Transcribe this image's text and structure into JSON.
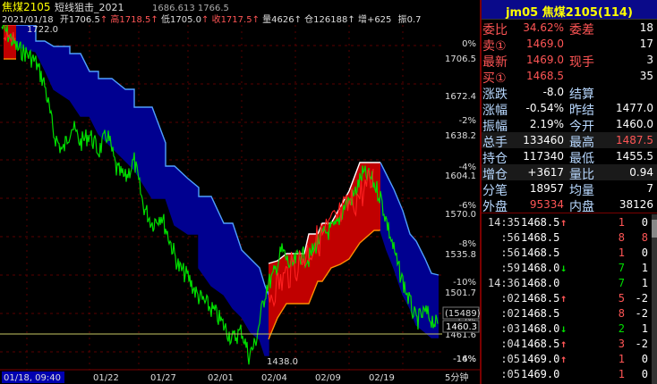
{
  "chart": {
    "symbol": "焦煤2105",
    "indicator": "短线狙击_2021",
    "indicator_values": "1686.613  1766.5",
    "info_date": "2021/01/18",
    "info_open_label": "开",
    "info_open": "1706.5",
    "info_high_label": "高",
    "info_high": "1718.5",
    "info_low_label": "低",
    "info_low": "1705.0",
    "info_close_label": "收",
    "info_close": "1717.5",
    "info_vol_label": "量",
    "info_vol": "4626",
    "info_oi_label": "仓",
    "info_oi": "126188",
    "info_add_label": "增",
    "info_add": "+625",
    "info_amp_label": "振",
    "info_amp": "0.7",
    "y_labels": [
      {
        "pct": "0%",
        "price": "1706.5"
      },
      {
        "pct": "-2%",
        "price": "1672.4"
      },
      {
        "pct": "-4%",
        "price": "1638.2"
      },
      {
        "pct": "-6%",
        "price": "1604.1"
      },
      {
        "pct": "-8%",
        "price": "1570.0"
      },
      {
        "pct": "-10%",
        "price": "1535.8"
      },
      {
        "pct": "-12%",
        "price": "1501.7"
      },
      {
        "pct": "-14%",
        "price": "1461.6"
      },
      {
        "pct": "-16%",
        "price": ""
      }
    ],
    "price_max_label": "1722.0",
    "price_min_label": "1438.0",
    "current_price": "1460.3",
    "current_count": "(15489)",
    "x_labels": [
      "01/18, 09:40",
      "01/22",
      "01/27",
      "02/01",
      "02/04",
      "02/09",
      "02/19"
    ],
    "period": "5分钟",
    "colors": {
      "bull_band": "#c00000",
      "bear_band": "#000080",
      "price_up": "#00e000",
      "grid": "#5a0000"
    }
  },
  "panel": {
    "header": "jm05 焦煤2105(114)",
    "rows": [
      {
        "l1": "委比",
        "v1": "34.62%",
        "c1": "red",
        "l2": "委差",
        "v2": "18",
        "c2": "wht"
      },
      {
        "l1": "卖①",
        "v1": "1469.0",
        "c1": "red",
        "l2": "",
        "v2": "17",
        "c2": "wht"
      },
      {
        "l1": "最新",
        "v1": "1469.0",
        "c1": "red",
        "l2": "现手",
        "v2": "3",
        "c2": "wht"
      },
      {
        "l1": "买①",
        "v1": "1468.5",
        "c1": "red",
        "l2": "",
        "v2": "35",
        "c2": "wht"
      },
      {
        "l1": "涨跌",
        "v1": "-8.0",
        "c1": "wht",
        "l2": "结算",
        "v2": "",
        "c2": "wht"
      },
      {
        "l1": "涨幅",
        "v1": "-0.54%",
        "c1": "wht",
        "l2": "昨结",
        "v2": "1477.0",
        "c2": "wht"
      },
      {
        "l1": "振幅",
        "v1": "2.19%",
        "c1": "wht",
        "l2": "今开",
        "v2": "1460.0",
        "c2": "wht"
      },
      {
        "l1": "总手",
        "v1": "133460",
        "c1": "wht",
        "l2": "最高",
        "v2": "1487.5",
        "c2": "red"
      },
      {
        "l1": "持仓",
        "v1": "117340",
        "c1": "wht",
        "l2": "最低",
        "v2": "1455.5",
        "c2": "wht"
      },
      {
        "l1": "增仓",
        "v1": "+3617",
        "c1": "wht",
        "l2": "量比",
        "v2": "0.94",
        "c2": "wht"
      },
      {
        "l1": "分笔",
        "v1": "18957",
        "c1": "wht",
        "l2": "均量",
        "v2": "7",
        "c2": "wht"
      },
      {
        "l1": "外盘",
        "v1": "95334",
        "c1": "red",
        "l2": "内盘",
        "v2": "38126",
        "c2": "wht"
      }
    ],
    "ticks": [
      {
        "time": "14:35",
        "price": "1468.5",
        "dir": "↑",
        "dc": "red",
        "vol": "1",
        "vc": "red",
        "chg": "0",
        "cc": "wht"
      },
      {
        "time": ":56",
        "price": "1468.5",
        "dir": "",
        "dc": "wht",
        "vol": "8",
        "vc": "red",
        "chg": "8",
        "cc": "red"
      },
      {
        "time": ":56",
        "price": "1468.5",
        "dir": "",
        "dc": "wht",
        "vol": "1",
        "vc": "red",
        "chg": "0",
        "cc": "wht"
      },
      {
        "time": ":59",
        "price": "1468.0",
        "dir": "↓",
        "dc": "grn",
        "vol": "7",
        "vc": "grn",
        "chg": "1",
        "cc": "wht"
      },
      {
        "time": "14:36",
        "price": "1468.0",
        "dir": "",
        "dc": "wht",
        "vol": "7",
        "vc": "grn",
        "chg": "1",
        "cc": "wht"
      },
      {
        "time": ":02",
        "price": "1468.5",
        "dir": "↑",
        "dc": "red",
        "vol": "5",
        "vc": "red",
        "chg": "-2",
        "cc": "wht"
      },
      {
        "time": ":02",
        "price": "1468.5",
        "dir": "",
        "dc": "wht",
        "vol": "8",
        "vc": "red",
        "chg": "-2",
        "cc": "wht"
      },
      {
        "time": ":03",
        "price": "1468.0",
        "dir": "↓",
        "dc": "grn",
        "vol": "2",
        "vc": "grn",
        "chg": "1",
        "cc": "wht"
      },
      {
        "time": ":04",
        "price": "1468.5",
        "dir": "↑",
        "dc": "red",
        "vol": "3",
        "vc": "red",
        "chg": "-2",
        "cc": "wht"
      },
      {
        "time": ":05",
        "price": "1469.0",
        "dir": "↑",
        "dc": "red",
        "vol": "1",
        "vc": "red",
        "chg": "0",
        "cc": "wht"
      },
      {
        "time": ":05",
        "price": "1469.0",
        "dir": "",
        "dc": "wht",
        "vol": "1",
        "vc": "red",
        "chg": "0",
        "cc": "wht"
      }
    ]
  }
}
